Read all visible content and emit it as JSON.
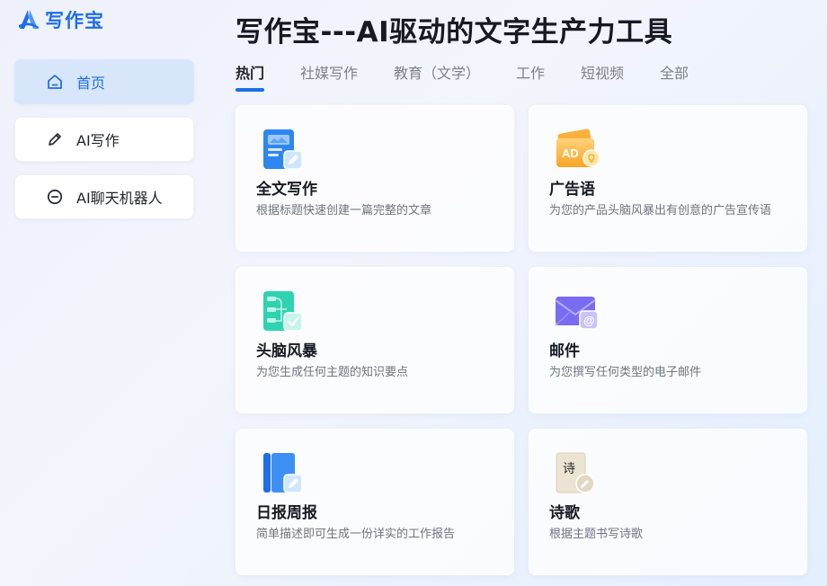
{
  "brand": {
    "name": "写作宝"
  },
  "sidebar": {
    "items": [
      {
        "label": "首页",
        "icon": "home-icon",
        "active": true
      },
      {
        "label": "AI写作",
        "icon": "pencil-icon",
        "active": false
      },
      {
        "label": "AI聊天机器人",
        "icon": "chat-bubble-icon",
        "active": false
      }
    ]
  },
  "main": {
    "title": "写作宝---AI驱动的文字生产力工具",
    "tabs": [
      {
        "label": "热门",
        "active": true
      },
      {
        "label": "社媒写作",
        "active": false
      },
      {
        "label": "教育（文学）",
        "active": false
      },
      {
        "label": "工作",
        "active": false
      },
      {
        "label": "短视频",
        "active": false
      },
      {
        "label": "全部",
        "active": false
      }
    ],
    "cards": [
      {
        "title": "全文写作",
        "desc": "根据标题快速创建一篇完整的文章",
        "icon": "document-edit-icon"
      },
      {
        "title": "广告语",
        "desc": "为您的产品头脑风暴出有创意的广告宣传语",
        "icon": "ad-card-icon"
      },
      {
        "title": "头脑风暴",
        "desc": "为您生成任何主题的知识要点",
        "icon": "mind-map-icon"
      },
      {
        "title": "邮件",
        "desc": "为您撰写任何类型的电子邮件",
        "icon": "mail-icon"
      },
      {
        "title": "日报周报",
        "desc": "简单描述即可生成一份详实的工作报告",
        "icon": "notebook-icon"
      },
      {
        "title": "诗歌",
        "desc": "根据主题书写诗歌",
        "icon": "poem-scroll-icon"
      }
    ]
  },
  "icon_text": {
    "ad": "AD",
    "poem": "诗"
  },
  "colors": {
    "accent": "#1e6ee8",
    "active_nav_bg": "#d8e6fb"
  }
}
